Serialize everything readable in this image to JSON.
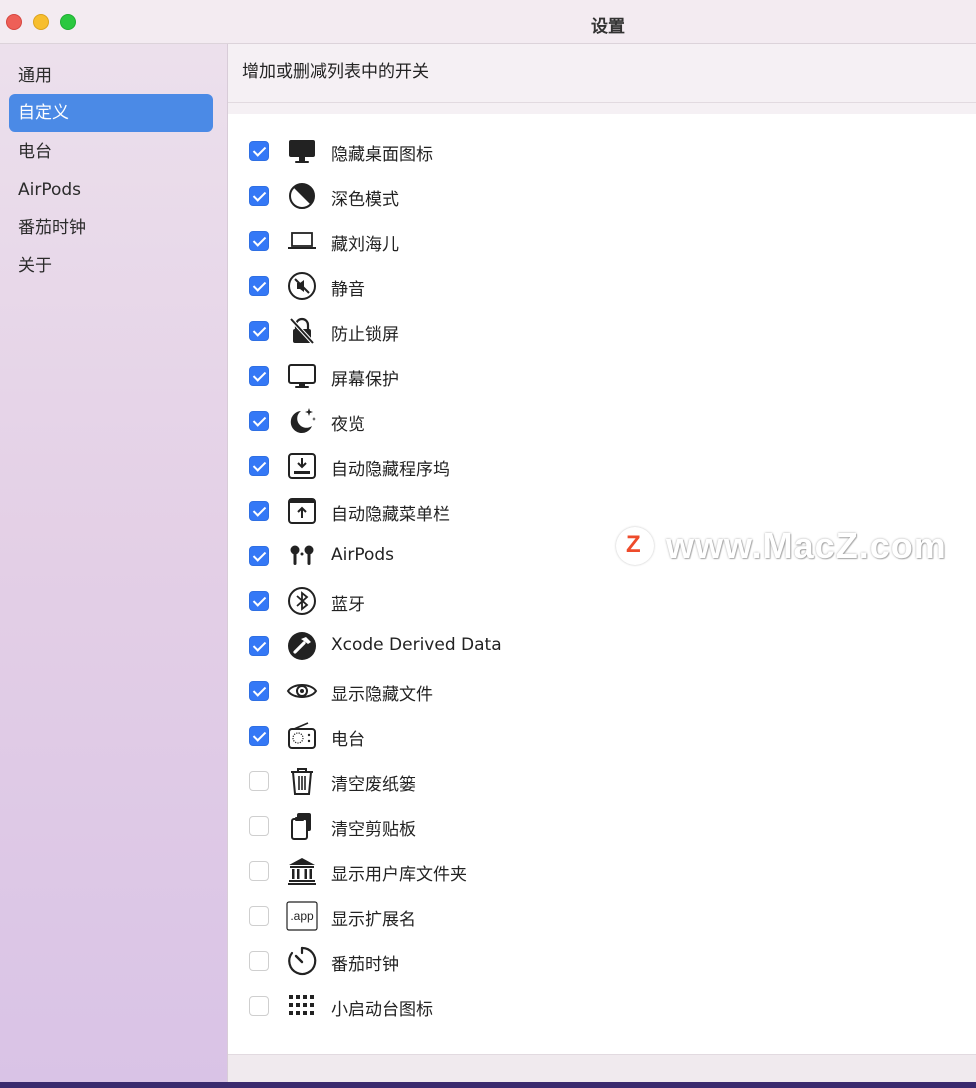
{
  "window": {
    "title": "设置"
  },
  "sidebar": {
    "items": [
      {
        "label": "通用",
        "active": false
      },
      {
        "label": "自定义",
        "active": true
      },
      {
        "label": "电台",
        "active": false
      },
      {
        "label": "AirPods",
        "active": false
      },
      {
        "label": "番茄时钟",
        "active": false
      },
      {
        "label": "关于",
        "active": false
      }
    ]
  },
  "main": {
    "heading": "增加或删减列表中的开关",
    "items": [
      {
        "label": "隐藏桌面图标",
        "checked": true,
        "icon": "desktop-icon"
      },
      {
        "label": "深色模式",
        "checked": true,
        "icon": "dark-mode-icon"
      },
      {
        "label": "藏刘海儿",
        "checked": true,
        "icon": "laptop-icon"
      },
      {
        "label": "静音",
        "checked": true,
        "icon": "mute-icon"
      },
      {
        "label": "防止锁屏",
        "checked": true,
        "icon": "lock-slash-icon"
      },
      {
        "label": "屏幕保护",
        "checked": true,
        "icon": "display-icon"
      },
      {
        "label": "夜览",
        "checked": true,
        "icon": "moon-stars-icon"
      },
      {
        "label": "自动隐藏程序坞",
        "checked": true,
        "icon": "dock-icon"
      },
      {
        "label": "自动隐藏菜单栏",
        "checked": true,
        "icon": "menubar-icon"
      },
      {
        "label": "AirPods",
        "checked": true,
        "icon": "airpods-icon"
      },
      {
        "label": "蓝牙",
        "checked": true,
        "icon": "bluetooth-icon"
      },
      {
        "label": "Xcode Derived Data",
        "checked": true,
        "icon": "hammer-icon"
      },
      {
        "label": "显示隐藏文件",
        "checked": true,
        "icon": "eye-icon"
      },
      {
        "label": "电台",
        "checked": true,
        "icon": "radio-icon"
      },
      {
        "label": "清空废纸篓",
        "checked": false,
        "icon": "trash-icon"
      },
      {
        "label": "清空剪贴板",
        "checked": false,
        "icon": "clipboard-icon"
      },
      {
        "label": "显示用户库文件夹",
        "checked": false,
        "icon": "library-icon"
      },
      {
        "label": "显示扩展名",
        "checked": false,
        "icon": "app-extension-icon",
        "icon_text": ".app"
      },
      {
        "label": "番茄时钟",
        "checked": false,
        "icon": "timer-icon"
      },
      {
        "label": "小启动台图标",
        "checked": false,
        "icon": "launchpad-grid-icon"
      }
    ]
  },
  "watermark": {
    "logo": "Z",
    "text": "www.MacZ.com"
  }
}
